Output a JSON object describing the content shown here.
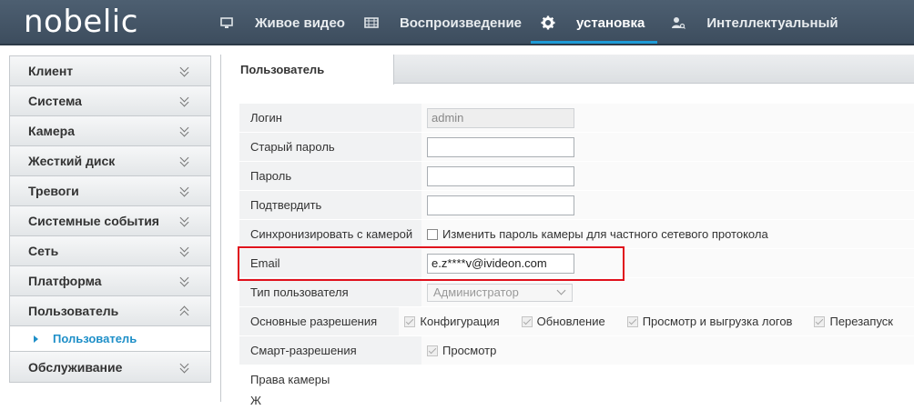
{
  "brand": {
    "logo": "nobelic"
  },
  "nav": [
    {
      "label": "Живое видео",
      "icon": "monitor-icon"
    },
    {
      "label": "Воспроизведение",
      "icon": "film-icon"
    },
    {
      "label": "установка",
      "icon": "gear-icon",
      "active": true
    },
    {
      "label": "Интеллектуальный",
      "icon": "user-search-icon"
    }
  ],
  "sidebar": {
    "items": [
      {
        "label": "Клиент"
      },
      {
        "label": "Система"
      },
      {
        "label": "Камера"
      },
      {
        "label": "Жесткий диск"
      },
      {
        "label": "Тревоги"
      },
      {
        "label": "Системные события"
      },
      {
        "label": "Сеть"
      },
      {
        "label": "Платформа"
      },
      {
        "label": "Пользователь",
        "expanded": true
      },
      {
        "label": "Обслуживание"
      }
    ],
    "subitem": {
      "label": "Пользователь"
    }
  },
  "tab": {
    "label": "Пользователь"
  },
  "form": {
    "login_label": "Логин",
    "login_value": "admin",
    "old_password_label": "Старый пароль",
    "password_label": "Пароль",
    "confirm_label": "Подтвердить",
    "sync_label": "Синхронизировать с камерой",
    "sync_checkbox_label": "Изменить пароль камеры для частного сетевого протокола",
    "email_label": "Email",
    "email_value": "e.z****v@ivideon.com",
    "user_type_label": "Тип пользователя",
    "user_type_value": "Администратор",
    "basic_perms_label": "Основные разрешения",
    "basic_perms": [
      "Конфигурация",
      "Обновление",
      "Просмотр и выгрузка логов",
      "Перезапуск"
    ],
    "smart_perms_label": "Смарт-разрешения",
    "smart_perms": [
      "Просмотр"
    ],
    "camera_rights_label": "Права камеры",
    "camera_rights_partial": "Ж"
  },
  "colors": {
    "accent": "#1e9bd7",
    "highlight": "#e0101c",
    "topbar": "#45566a"
  }
}
